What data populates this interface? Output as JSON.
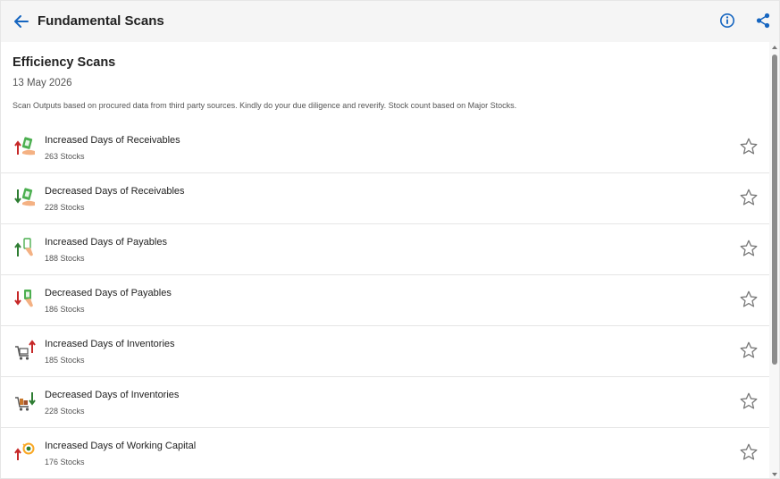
{
  "header": {
    "title": "Fundamental Scans",
    "back_icon": "back-arrow-icon",
    "info_icon": "info-icon",
    "share_icon": "share-icon",
    "accent_color": "#1565c0"
  },
  "section": {
    "title": "Efficiency Scans",
    "date": "13 May 2026",
    "disclaimer": "Scan Outputs based on procured data from third party sources. Kindly do your due diligence and reverify. Stock count based on Major Stocks."
  },
  "scans": [
    {
      "title": "Increased Days of Receivables",
      "count": "263 Stocks",
      "icon": "receivables-up-icon"
    },
    {
      "title": "Decreased Days of Receivables",
      "count": "228 Stocks",
      "icon": "receivables-down-icon"
    },
    {
      "title": "Increased Days of Payables",
      "count": "188 Stocks",
      "icon": "payables-up-icon"
    },
    {
      "title": "Decreased Days of Payables",
      "count": "186 Stocks",
      "icon": "payables-down-icon"
    },
    {
      "title": "Increased Days of Inventories",
      "count": "185 Stocks",
      "icon": "inventories-up-icon"
    },
    {
      "title": "Decreased Days of Inventories",
      "count": "228 Stocks",
      "icon": "inventories-down-icon"
    },
    {
      "title": "Increased Days of Working Capital",
      "count": "176 Stocks",
      "icon": "working-capital-up-icon"
    }
  ],
  "colors": {
    "up_arrow": "#c62828",
    "down_arrow": "#2e7d32",
    "green_arrow": "#2e7d32",
    "star": "#777777"
  }
}
